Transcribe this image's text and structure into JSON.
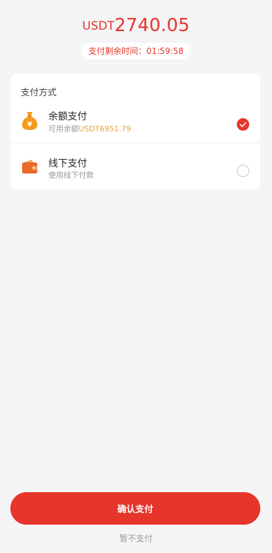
{
  "payment": {
    "currency": "USDT",
    "amount": "2740.05",
    "timer_label": "支付剩余时间：",
    "timer_value": "01:59:58"
  },
  "methods": {
    "title": "支付方式",
    "options": [
      {
        "label": "余额支付",
        "sub_prefix": "可用余额",
        "sub_value": "USDT6951.79",
        "icon": "money-bag-icon",
        "selected": true
      },
      {
        "label": "线下支付",
        "sub_prefix": "使用线下付款",
        "icon": "wallet-icon",
        "selected": false
      }
    ]
  },
  "actions": {
    "confirm_label": "确认支付",
    "later_label": "暂不支付"
  },
  "colors": {
    "accent": "#e6352a",
    "highlight": "#e6a23c",
    "icon_orange": "#f39a1e",
    "background": "#f5f4f6"
  }
}
